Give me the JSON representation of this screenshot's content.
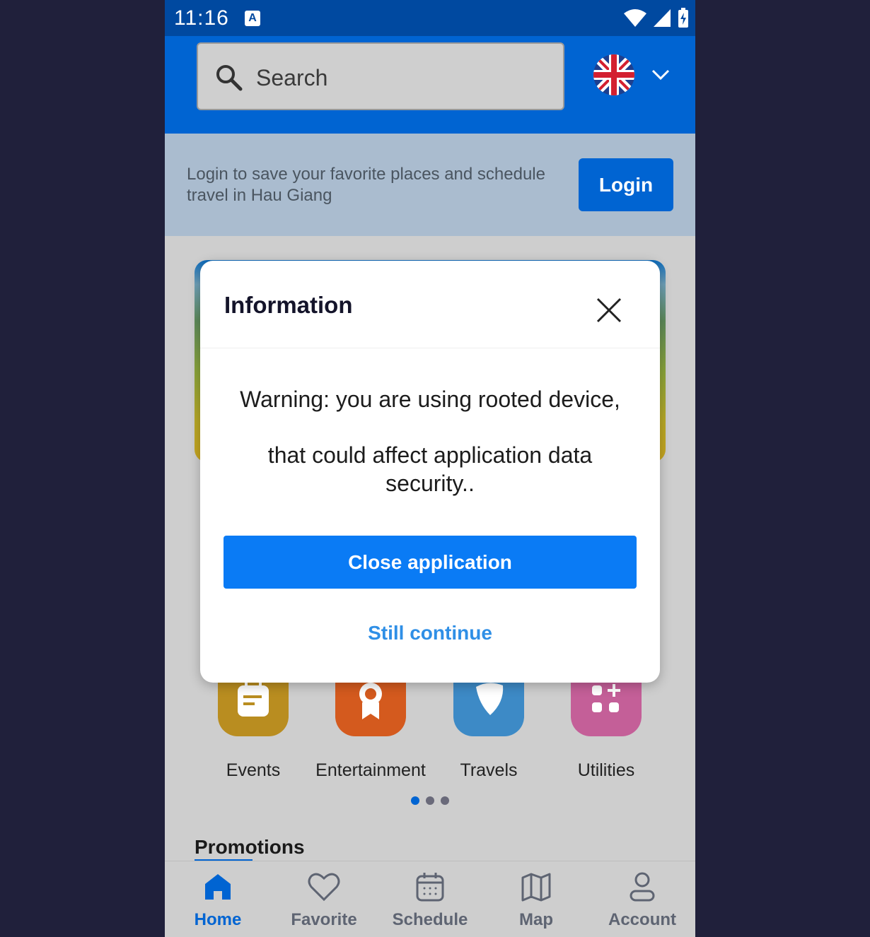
{
  "status_bar": {
    "time": "11:16",
    "notification_icon_letter": "A"
  },
  "search": {
    "placeholder": "Search"
  },
  "language": {
    "flag_icon": "uk-flag-icon"
  },
  "login_banner": {
    "message": "Login to save your favorite places and schedule travel in Hau Giang",
    "button_label": "Login"
  },
  "categories": [
    {
      "label": "Events",
      "color": "#b98d20",
      "icon": "calendar-note-icon"
    },
    {
      "label": "Entertainment",
      "color": "#d45a1e",
      "icon": "award-ribbon-icon"
    },
    {
      "label": "Travels",
      "color": "#3d8ac6",
      "icon": "pin-icon"
    },
    {
      "label": "Utilities",
      "color": "#c45f98",
      "icon": "grid-plus-icon"
    }
  ],
  "carousel": {
    "pages": 3,
    "active_index": 0
  },
  "sections": {
    "promotions_title": "Promotions"
  },
  "bottom_nav": [
    {
      "label": "Home",
      "icon": "home-icon",
      "active": true
    },
    {
      "label": "Favorite",
      "icon": "heart-icon",
      "active": false
    },
    {
      "label": "Schedule",
      "icon": "calendar-icon",
      "active": false
    },
    {
      "label": "Map",
      "icon": "map-icon",
      "active": false
    },
    {
      "label": "Account",
      "icon": "user-icon",
      "active": false
    }
  ],
  "dialog": {
    "title": "Information",
    "message_line1": "Warning: you are using rooted device,",
    "message_line2": "that could affect application data security..",
    "primary_button": "Close application",
    "secondary_button": "Still continue"
  },
  "colors": {
    "brand_blue": "#0064d2",
    "status_bar": "#0049a0",
    "dialog_primary": "#0a7bf5",
    "dialog_link": "#2f8fe6"
  }
}
